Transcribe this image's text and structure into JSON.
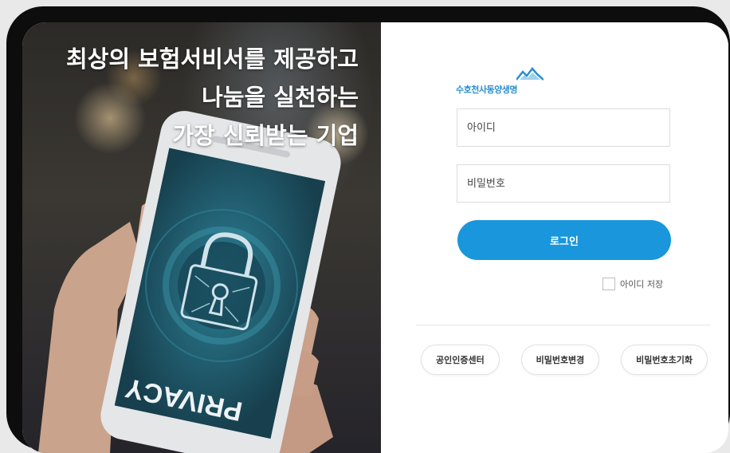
{
  "hero": {
    "lines": [
      "최상의 보험서비서를 제공하고",
      "나눔을 실천하는",
      "가장 신뢰받는 기업"
    ],
    "phone_label": "PRIVACY",
    "illustration_icon": "padlock-icon"
  },
  "brand": {
    "name": "수호천사동양생명",
    "mark_icon": "mountain-logo-icon",
    "color": "#2a8fcf"
  },
  "login": {
    "id_placeholder": "아이디",
    "password_placeholder": "비밀번호",
    "submit_label": "로그인",
    "remember_label": "아이디 저장",
    "remember_checked": false,
    "accent": "#1a96dc"
  },
  "links": [
    "공인인증센터",
    "비밀번호변경",
    "비밀번호초기화"
  ]
}
